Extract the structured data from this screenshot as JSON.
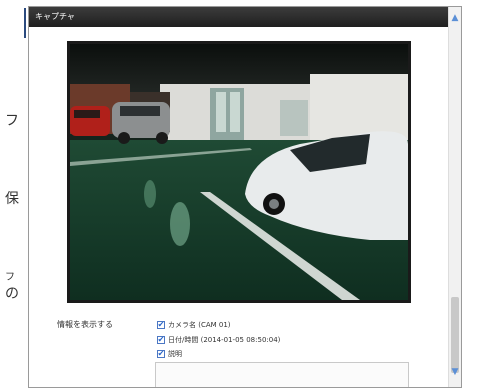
{
  "background": {
    "fragments": [
      "フ",
      "保",
      "フ",
      "の"
    ]
  },
  "dialog": {
    "title": "キャプチャ",
    "info_label": "情報を表示する",
    "checkboxes": [
      {
        "label": "カメラ名 (CAM 01)",
        "checked": true
      },
      {
        "label": "日付/時間 (2014-01-05 08:50:04)",
        "checked": true
      },
      {
        "label": "説明",
        "checked": true
      }
    ],
    "description_value": ""
  },
  "icons": {
    "scroll_up": "chevron-up-icon",
    "scroll_down": "chevron-down-icon",
    "checkbox": "check-icon"
  },
  "colors": {
    "titlebar": "#2a2a2a",
    "accent": "#4b77c4"
  }
}
